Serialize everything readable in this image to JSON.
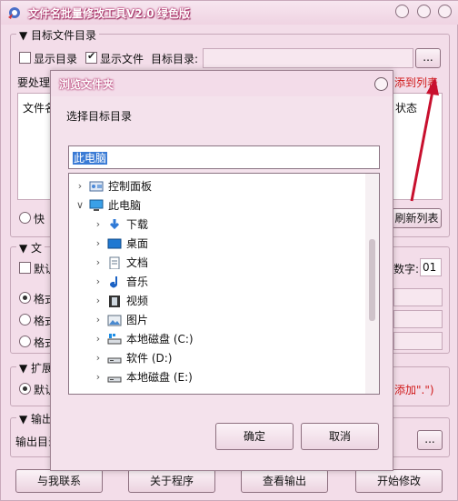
{
  "window": {
    "title": "文件名批量修改工具V2.0",
    "edition": "绿色版"
  },
  "target_group": {
    "title": "目标文件目录",
    "show_dirs": "显示目录",
    "show_files": "显示文件",
    "target_dir_label": "目标目录:",
    "browse": "...",
    "process_label": "要处理",
    "add_hint": "添到列表",
    "col_file": "文件名",
    "col_status": "状态",
    "radio_fast": "快",
    "refresh": "刷新列表"
  },
  "file_group": {
    "title": "文",
    "default": "默认",
    "digits_label": "数字:",
    "digits_value": "01",
    "fmt1": "格式",
    "fmt2": "格式",
    "fmt3": "格式"
  },
  "ext_group": {
    "title": "扩展",
    "default": "默认",
    "hint": "添加\".\")"
  },
  "output_group": {
    "title": "输出",
    "dir_label": "输出目录",
    "browse": "..."
  },
  "bottom": {
    "contact": "与我联系",
    "about": "关于程序",
    "view_output": "查看输出",
    "start": "开始修改"
  },
  "dialog": {
    "title": "浏览文件夹",
    "prompt": "选择目标目录",
    "path_value": "此电脑",
    "tree": [
      {
        "label": "控制面板",
        "icon": "control-panel-icon",
        "level": 0,
        "expanded": false
      },
      {
        "label": "此电脑",
        "icon": "computer-icon",
        "level": 0,
        "expanded": true
      },
      {
        "label": "下载",
        "icon": "download-folder-icon",
        "level": 1,
        "expanded": false
      },
      {
        "label": "桌面",
        "icon": "desktop-folder-icon",
        "level": 1,
        "expanded": false
      },
      {
        "label": "文档",
        "icon": "documents-folder-icon",
        "level": 1,
        "expanded": false
      },
      {
        "label": "音乐",
        "icon": "music-folder-icon",
        "level": 1,
        "expanded": false
      },
      {
        "label": "视频",
        "icon": "video-folder-icon",
        "level": 1,
        "expanded": false
      },
      {
        "label": "图片",
        "icon": "pictures-folder-icon",
        "level": 1,
        "expanded": false
      },
      {
        "label": "本地磁盘 (C:)",
        "icon": "drive-c-icon",
        "level": 1,
        "expanded": false
      },
      {
        "label": "软件 (D:)",
        "icon": "drive-d-icon",
        "level": 1,
        "expanded": false
      },
      {
        "label": "本地磁盘 (E:)",
        "icon": "drive-e-icon",
        "level": 1,
        "expanded": false
      }
    ],
    "ok": "确定",
    "cancel": "取消"
  }
}
